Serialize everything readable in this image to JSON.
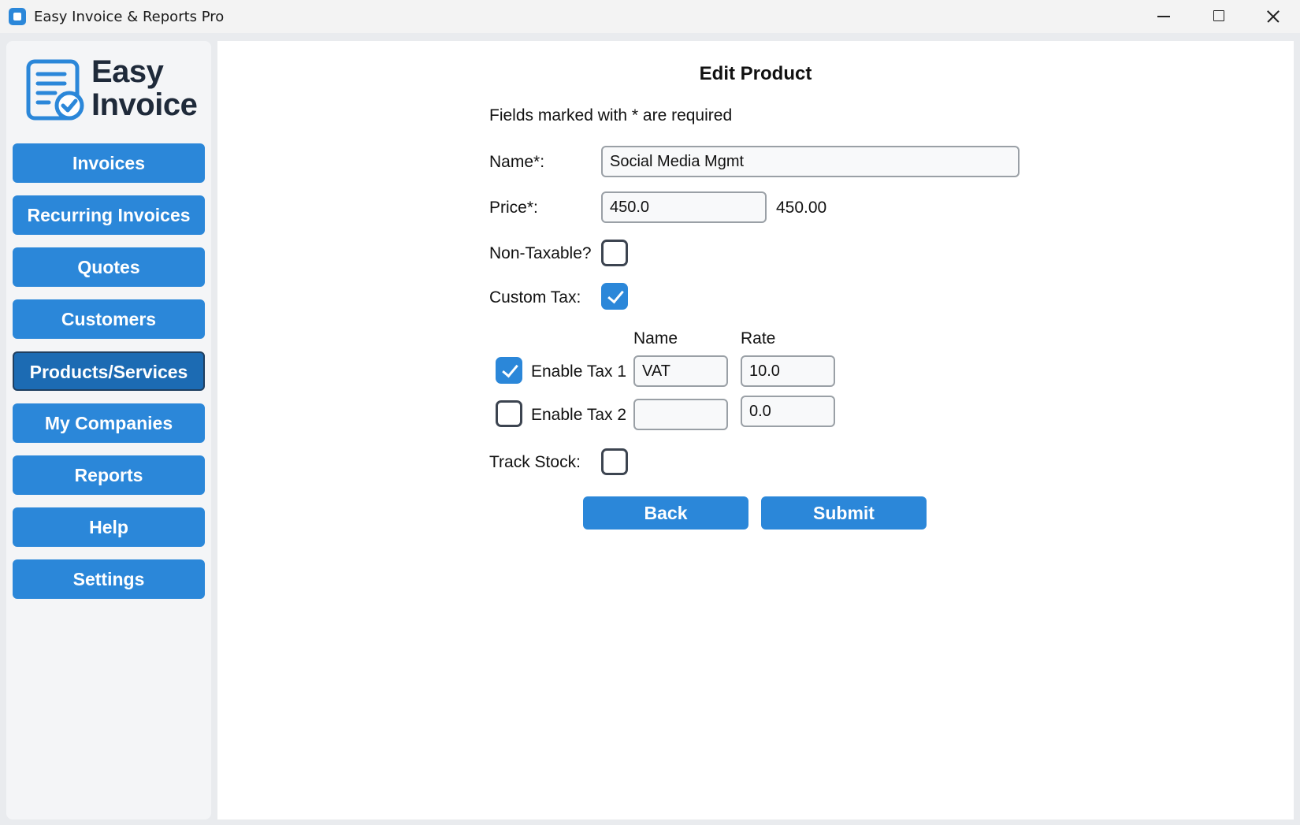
{
  "window": {
    "title": "Easy Invoice & Reports Pro"
  },
  "logo": {
    "line1": "Easy",
    "line2": "Invoice",
    "icon": "invoice-document-check-icon"
  },
  "sidebar": {
    "items": [
      {
        "label": "Invoices"
      },
      {
        "label": "Recurring Invoices"
      },
      {
        "label": "Quotes"
      },
      {
        "label": "Customers"
      },
      {
        "label": "Products/Services",
        "active": true
      },
      {
        "label": "My Companies"
      },
      {
        "label": "Reports"
      },
      {
        "label": "Help"
      },
      {
        "label": "Settings"
      }
    ]
  },
  "form": {
    "title": "Edit Product",
    "required_note": "Fields marked with * are required",
    "name_label": "Name*:",
    "name_value": "Social Media Mgmt",
    "price_label": "Price*:",
    "price_value": "450.0",
    "price_display": "450.00",
    "non_taxable_label": "Non-Taxable?",
    "non_taxable_checked": false,
    "custom_tax_label": "Custom Tax:",
    "custom_tax_checked": true,
    "tax_col_name": "Name",
    "tax_col_rate": "Rate",
    "taxes": [
      {
        "label": "Enable Tax 1",
        "enabled": true,
        "name": "VAT",
        "rate": "10.0"
      },
      {
        "label": "Enable Tax 2",
        "enabled": false,
        "name": "",
        "rate": "0.0"
      }
    ],
    "track_stock_label": "Track Stock:",
    "track_stock_checked": false,
    "back_label": "Back",
    "submit_label": "Submit"
  },
  "colors": {
    "accent": "#2b87d9",
    "active_nav": "#1c6bb3",
    "sidebar_bg": "#f4f5f7"
  }
}
